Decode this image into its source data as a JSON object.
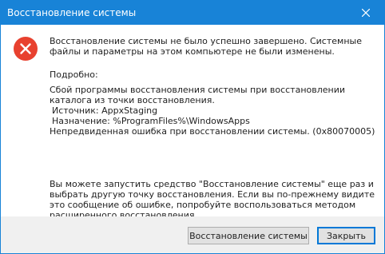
{
  "window": {
    "title": "Восстановление системы"
  },
  "icons": {
    "close": "close-icon",
    "error": "error-icon"
  },
  "colors": {
    "titlebar": "#1883d7",
    "error_icon": "#e8412f",
    "footer": "#f0f0f0",
    "default_button_border": "#0078d7"
  },
  "message": {
    "main": "Восстановление системы не было успешно завершено. Системные файлы и параметры на этом компьютере не были изменены.",
    "details_heading": "Подробно:",
    "details_line1": "Сбой программы восстановления системы при восстановлении каталога из точки восстановления.",
    "source": " Источник: AppxStaging",
    "destination": " Назначение: %ProgramFiles%\\WindowsApps",
    "error_line": "Непредвиденная ошибка при восстановлении системы. (0x80070005)",
    "advice": "Вы можете запустить средство \"Восстановление системы\" еще раз и выбрать другую точку восстановления. Если вы по-прежнему видите это сообщение об ошибке, попробуйте воспользоваться методом расширенного восстановления."
  },
  "buttons": {
    "restore": "Восстановление системы",
    "close": "Закрыть"
  }
}
